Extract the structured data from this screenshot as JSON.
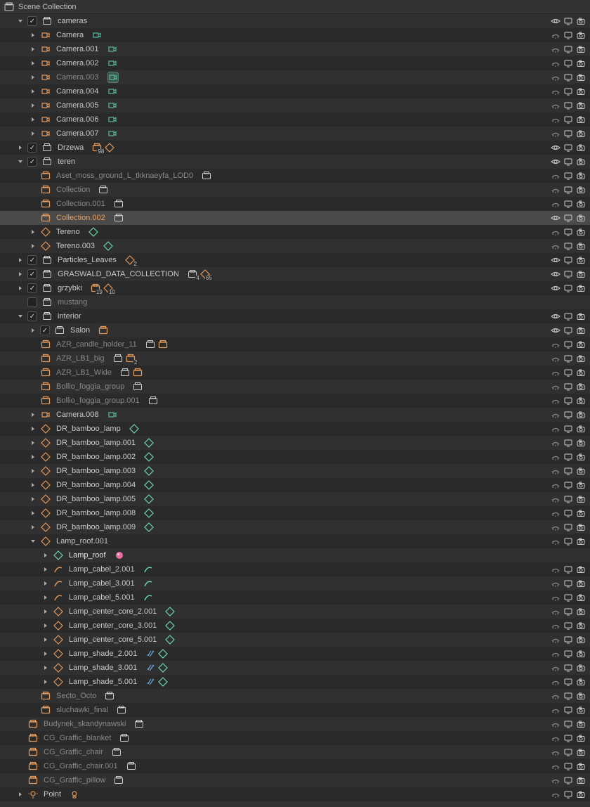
{
  "header": {
    "title": "Scene Collection"
  },
  "colors": {
    "outline_white": "#cccccc",
    "orange": "#e0985a",
    "teal": "#55b5a0",
    "green_mesh": "#6bd8a8",
    "gray_dim": "#888888",
    "pink": "#e86fa0",
    "yellow_curve": "#d8b060"
  },
  "rows": [
    {
      "indent": 1,
      "disclosure": "down",
      "checkbox": true,
      "icon": "collection-white",
      "label": "cameras",
      "right": [
        "eye",
        "screen",
        "camera"
      ]
    },
    {
      "indent": 2,
      "disclosure": "closed",
      "icon": "camera-orange",
      "label": "Camera",
      "trailing": [
        {
          "t": "camcorder-green"
        }
      ],
      "right": [
        "hide",
        "screen",
        "camera"
      ]
    },
    {
      "indent": 2,
      "disclosure": "closed",
      "icon": "camera-orange",
      "label": "Camera.001",
      "trailing": [
        {
          "t": "camcorder-green"
        }
      ],
      "right": [
        "hide",
        "screen",
        "camera"
      ]
    },
    {
      "indent": 2,
      "disclosure": "closed",
      "icon": "camera-orange",
      "label": "Camera.002",
      "trailing": [
        {
          "t": "camcorder-green"
        }
      ],
      "right": [
        "hide",
        "screen",
        "camera"
      ]
    },
    {
      "indent": 2,
      "disclosure": "closed",
      "icon": "camera-orange",
      "label": "Camera.003",
      "labelDim": true,
      "trailing": [
        {
          "t": "camcorder-green-box"
        }
      ],
      "right": [
        "hide",
        "screen",
        "camera"
      ]
    },
    {
      "indent": 2,
      "disclosure": "closed",
      "icon": "camera-orange",
      "label": "Camera.004",
      "trailing": [
        {
          "t": "camcorder-green"
        }
      ],
      "right": [
        "hide",
        "screen",
        "camera"
      ]
    },
    {
      "indent": 2,
      "disclosure": "closed",
      "icon": "camera-orange",
      "label": "Camera.005",
      "trailing": [
        {
          "t": "camcorder-green"
        }
      ],
      "right": [
        "hide",
        "screen",
        "camera"
      ]
    },
    {
      "indent": 2,
      "disclosure": "closed",
      "icon": "camera-orange",
      "label": "Camera.006",
      "trailing": [
        {
          "t": "camcorder-green"
        }
      ],
      "right": [
        "hide",
        "screen",
        "camera"
      ]
    },
    {
      "indent": 2,
      "disclosure": "closed",
      "icon": "camera-orange",
      "label": "Camera.007",
      "trailing": [
        {
          "t": "camcorder-green"
        }
      ],
      "right": [
        "hide",
        "screen",
        "camera"
      ]
    },
    {
      "indent": 1,
      "disclosure": "closed",
      "checkbox": true,
      "icon": "collection-white",
      "label": "Drzewa",
      "trailing": [
        {
          "t": "collection-orange",
          "n": "98"
        },
        {
          "t": "mesh-orange"
        }
      ],
      "right": [
        "eye",
        "screen",
        "camera"
      ]
    },
    {
      "indent": 1,
      "disclosure": "down",
      "checkbox": true,
      "icon": "collection-white",
      "label": "teren",
      "right": [
        "eye",
        "screen",
        "camera"
      ]
    },
    {
      "indent": 2,
      "disclosure": "none",
      "icon": "collection-orange",
      "label": "Aset_moss_ground_L_tkknaeyfa_LOD0",
      "labelDim": true,
      "trailing": [
        {
          "t": "collection-white"
        }
      ],
      "right": [
        "hide",
        "screen",
        "camera"
      ]
    },
    {
      "indent": 2,
      "disclosure": "none",
      "icon": "collection-orange",
      "label": "Collection",
      "labelDim": true,
      "trailing": [
        {
          "t": "collection-white"
        }
      ],
      "right": [
        "hide",
        "screen",
        "camera"
      ]
    },
    {
      "indent": 2,
      "disclosure": "none",
      "icon": "collection-orange",
      "label": "Collection.001",
      "labelDim": true,
      "trailing": [
        {
          "t": "collection-white"
        }
      ],
      "right": [
        "hide",
        "screen",
        "camera"
      ]
    },
    {
      "indent": 2,
      "disclosure": "none",
      "icon": "collection-orange",
      "label": "Collection.002",
      "orangeLabel": true,
      "active": true,
      "trailing": [
        {
          "t": "collection-white"
        }
      ],
      "right": [
        "eye",
        "screen",
        "camera"
      ]
    },
    {
      "indent": 2,
      "disclosure": "closed",
      "icon": "mesh-orange",
      "label": "Tereno",
      "trailing": [
        {
          "t": "mesh-green"
        }
      ],
      "right": [
        "hide",
        "screen",
        "camera"
      ]
    },
    {
      "indent": 2,
      "disclosure": "closed",
      "icon": "mesh-orange",
      "label": "Tereno.003",
      "trailing": [
        {
          "t": "mesh-green"
        }
      ],
      "right": [
        "hide",
        "screen",
        "camera"
      ]
    },
    {
      "indent": 1,
      "disclosure": "closed",
      "checkbox": true,
      "icon": "collection-white",
      "label": "Particles_Leaves",
      "trailing": [
        {
          "t": "mesh-orange",
          "n": "2"
        }
      ],
      "right": [
        "eye",
        "screen",
        "camera"
      ]
    },
    {
      "indent": 1,
      "disclosure": "closed",
      "checkbox": true,
      "icon": "collection-white",
      "label": "GRASWALD_DATA_COLLECTION",
      "trailing": [
        {
          "t": "collection-white",
          "n": "4"
        },
        {
          "t": "mesh-orange",
          "n": "65"
        }
      ],
      "right": [
        "eye",
        "screen",
        "camera"
      ]
    },
    {
      "indent": 1,
      "disclosure": "closed",
      "checkbox": true,
      "icon": "collection-white",
      "label": "grzybki",
      "trailing": [
        {
          "t": "collection-orange",
          "n": "19"
        },
        {
          "t": "mesh-orange",
          "n": "10"
        }
      ],
      "right": [
        "eye",
        "screen",
        "camera"
      ]
    },
    {
      "indent": 1,
      "disclosure": "none",
      "checkbox": false,
      "icon": "collection-white",
      "label": "mustang",
      "labelDim": true
    },
    {
      "indent": 1,
      "disclosure": "down",
      "checkbox": true,
      "icon": "collection-white",
      "label": "interior",
      "right": [
        "eye",
        "screen",
        "camera"
      ]
    },
    {
      "indent": 2,
      "disclosure": "closed",
      "checkbox": true,
      "icon": "collection-white",
      "label": "Salon",
      "trailing": [
        {
          "t": "collection-orange"
        }
      ],
      "right": [
        "eye",
        "screen",
        "camera"
      ]
    },
    {
      "indent": 2,
      "disclosure": "none",
      "icon": "collection-orange",
      "label": "AZR_candle_holder_11",
      "labelDim": true,
      "trailing": [
        {
          "t": "collection-white"
        },
        {
          "t": "collection-orange"
        }
      ],
      "right": [
        "hide",
        "screen",
        "camera"
      ]
    },
    {
      "indent": 2,
      "disclosure": "none",
      "icon": "collection-orange",
      "label": "AZR_LB1_big",
      "labelDim": true,
      "trailing": [
        {
          "t": "collection-white"
        },
        {
          "t": "collection-orange",
          "n": "2"
        }
      ],
      "right": [
        "hide",
        "screen",
        "camera"
      ]
    },
    {
      "indent": 2,
      "disclosure": "none",
      "icon": "collection-orange",
      "label": "AZR_LB1_Wide",
      "labelDim": true,
      "trailing": [
        {
          "t": "collection-white"
        },
        {
          "t": "collection-orange"
        }
      ],
      "right": [
        "hide",
        "screen",
        "camera"
      ]
    },
    {
      "indent": 2,
      "disclosure": "none",
      "icon": "collection-orange",
      "label": "Bollio_foggia_group",
      "labelDim": true,
      "trailing": [
        {
          "t": "collection-white"
        }
      ],
      "right": [
        "hide",
        "screen",
        "camera"
      ]
    },
    {
      "indent": 2,
      "disclosure": "none",
      "icon": "collection-orange",
      "label": "Bollio_foggia_group.001",
      "labelDim": true,
      "trailing": [
        {
          "t": "collection-white"
        }
      ],
      "right": [
        "hide",
        "screen",
        "camera"
      ]
    },
    {
      "indent": 2,
      "disclosure": "closed",
      "icon": "camera-orange",
      "label": "Camera.008",
      "trailing": [
        {
          "t": "camcorder-green"
        }
      ],
      "right": [
        "hide",
        "screen",
        "camera"
      ]
    },
    {
      "indent": 2,
      "disclosure": "closed",
      "icon": "mesh-orange",
      "label": "DR_bamboo_lamp",
      "trailing": [
        {
          "t": "mesh-green"
        }
      ],
      "right": [
        "hide",
        "screen",
        "camera"
      ]
    },
    {
      "indent": 2,
      "disclosure": "closed",
      "icon": "mesh-orange",
      "label": "DR_bamboo_lamp.001",
      "trailing": [
        {
          "t": "mesh-green"
        }
      ],
      "right": [
        "hide",
        "screen",
        "camera"
      ]
    },
    {
      "indent": 2,
      "disclosure": "closed",
      "icon": "mesh-orange",
      "label": "DR_bamboo_lamp.002",
      "trailing": [
        {
          "t": "mesh-green"
        }
      ],
      "right": [
        "hide",
        "screen",
        "camera"
      ]
    },
    {
      "indent": 2,
      "disclosure": "closed",
      "icon": "mesh-orange",
      "label": "DR_bamboo_lamp.003",
      "trailing": [
        {
          "t": "mesh-green"
        }
      ],
      "right": [
        "hide",
        "screen",
        "camera"
      ]
    },
    {
      "indent": 2,
      "disclosure": "closed",
      "icon": "mesh-orange",
      "label": "DR_bamboo_lamp.004",
      "trailing": [
        {
          "t": "mesh-green"
        }
      ],
      "right": [
        "hide",
        "screen",
        "camera"
      ]
    },
    {
      "indent": 2,
      "disclosure": "closed",
      "icon": "mesh-orange",
      "label": "DR_bamboo_lamp.005",
      "trailing": [
        {
          "t": "mesh-green"
        }
      ],
      "right": [
        "hide",
        "screen",
        "camera"
      ]
    },
    {
      "indent": 2,
      "disclosure": "closed",
      "icon": "mesh-orange",
      "label": "DR_bamboo_lamp.008",
      "trailing": [
        {
          "t": "mesh-green"
        }
      ],
      "right": [
        "hide",
        "screen",
        "camera"
      ]
    },
    {
      "indent": 2,
      "disclosure": "closed",
      "icon": "mesh-orange",
      "label": "DR_bamboo_lamp.009",
      "trailing": [
        {
          "t": "mesh-green"
        }
      ],
      "right": [
        "hide",
        "screen",
        "camera"
      ]
    },
    {
      "indent": 2,
      "disclosure": "down",
      "icon": "mesh-orange",
      "label": "Lamp_roof.001",
      "right": [
        "hide",
        "screen",
        "camera"
      ]
    },
    {
      "indent": 3,
      "disclosure": "closed",
      "icon": "mesh-green",
      "label": "Lamp_roof",
      "whiteLabel": true,
      "trailing": [
        {
          "t": "material-pink"
        }
      ]
    },
    {
      "indent": 3,
      "disclosure": "closed",
      "icon": "curve-orange",
      "label": "Lamp_cabel_2.001",
      "trailing": [
        {
          "t": "curve-green"
        }
      ],
      "right": [
        "hide",
        "screen",
        "camera"
      ]
    },
    {
      "indent": 3,
      "disclosure": "closed",
      "icon": "curve-orange",
      "label": "Lamp_cabel_3.001",
      "trailing": [
        {
          "t": "curve-green"
        }
      ],
      "right": [
        "hide",
        "screen",
        "camera"
      ]
    },
    {
      "indent": 3,
      "disclosure": "closed",
      "icon": "curve-orange",
      "label": "Lamp_cabel_5.001",
      "trailing": [
        {
          "t": "curve-green"
        }
      ],
      "right": [
        "hide",
        "screen",
        "camera"
      ]
    },
    {
      "indent": 3,
      "disclosure": "closed",
      "icon": "mesh-orange",
      "label": "Lamp_center_core_2.001",
      "trailing": [
        {
          "t": "mesh-green"
        }
      ],
      "right": [
        "hide",
        "screen",
        "camera"
      ]
    },
    {
      "indent": 3,
      "disclosure": "closed",
      "icon": "mesh-orange",
      "label": "Lamp_center_core_3.001",
      "trailing": [
        {
          "t": "mesh-green"
        }
      ],
      "right": [
        "hide",
        "screen",
        "camera"
      ]
    },
    {
      "indent": 3,
      "disclosure": "closed",
      "icon": "mesh-orange",
      "label": "Lamp_center_core_5.001",
      "trailing": [
        {
          "t": "mesh-green"
        }
      ],
      "right": [
        "hide",
        "screen",
        "camera"
      ]
    },
    {
      "indent": 3,
      "disclosure": "closed",
      "icon": "mesh-orange",
      "label": "Lamp_shade_2.001",
      "trailing": [
        {
          "t": "modifier-teal"
        },
        {
          "t": "mesh-green"
        }
      ],
      "right": [
        "hide",
        "screen",
        "camera"
      ]
    },
    {
      "indent": 3,
      "disclosure": "closed",
      "icon": "mesh-orange",
      "label": "Lamp_shade_3.001",
      "trailing": [
        {
          "t": "modifier-teal"
        },
        {
          "t": "mesh-green"
        }
      ],
      "right": [
        "hide",
        "screen",
        "camera"
      ]
    },
    {
      "indent": 3,
      "disclosure": "closed",
      "icon": "mesh-orange",
      "label": "Lamp_shade_5.001",
      "trailing": [
        {
          "t": "modifier-teal"
        },
        {
          "t": "mesh-green"
        }
      ],
      "right": [
        "hide",
        "screen",
        "camera"
      ]
    },
    {
      "indent": 2,
      "disclosure": "none",
      "icon": "collection-orange",
      "label": "Secto_Octo",
      "labelDim": true,
      "trailing": [
        {
          "t": "collection-white"
        }
      ],
      "right": [
        "hide",
        "screen",
        "camera"
      ]
    },
    {
      "indent": 2,
      "disclosure": "none",
      "icon": "collection-orange",
      "label": "sluchawki_final",
      "labelDim": true,
      "trailing": [
        {
          "t": "collection-white"
        }
      ],
      "right": [
        "hide",
        "screen",
        "camera"
      ]
    },
    {
      "indent": 1,
      "disclosure": "none",
      "icon": "collection-orange",
      "label": "Budynek_skandynawski",
      "labelDim": true,
      "trailing": [
        {
          "t": "collection-white"
        }
      ],
      "right": [
        "hide",
        "screen",
        "camera"
      ]
    },
    {
      "indent": 1,
      "disclosure": "none",
      "icon": "collection-orange",
      "label": "CG_Graffic_blanket",
      "labelDim": true,
      "trailing": [
        {
          "t": "collection-white"
        }
      ],
      "right": [
        "hide",
        "screen",
        "camera"
      ]
    },
    {
      "indent": 1,
      "disclosure": "none",
      "icon": "collection-orange",
      "label": "CG_Graffic_chair",
      "labelDim": true,
      "trailing": [
        {
          "t": "collection-white"
        }
      ],
      "right": [
        "hide",
        "screen",
        "camera"
      ]
    },
    {
      "indent": 1,
      "disclosure": "none",
      "icon": "collection-orange",
      "label": "CG_Graffic_chair.001",
      "labelDim": true,
      "trailing": [
        {
          "t": "collection-white"
        }
      ],
      "right": [
        "hide",
        "screen",
        "camera"
      ]
    },
    {
      "indent": 1,
      "disclosure": "none",
      "icon": "collection-orange",
      "label": "CG_Graffic_pillow",
      "labelDim": true,
      "trailing": [
        {
          "t": "collection-white"
        }
      ],
      "right": [
        "hide",
        "screen",
        "camera"
      ]
    },
    {
      "indent": 1,
      "disclosure": "closed",
      "icon": "light-orange",
      "label": "Point",
      "trailing": [
        {
          "t": "light-data"
        }
      ],
      "right": [
        "hide",
        "screen",
        "camera"
      ]
    }
  ]
}
